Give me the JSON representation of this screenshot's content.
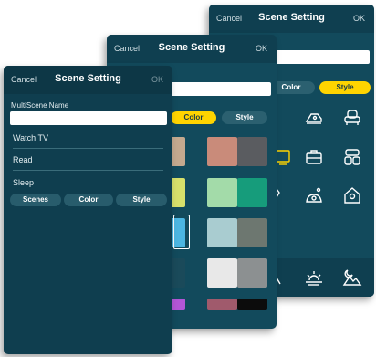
{
  "screen3": {
    "cancel": "Cancel",
    "title": "Scene Setting",
    "ok": "OK",
    "tabs": [
      {
        "label": "Color",
        "active": false
      },
      {
        "label": "Style",
        "active": true
      }
    ],
    "icons": [
      "thermostat-icon",
      "sofa-icon",
      "monitor-icon",
      "briefcase-icon",
      "lanterns-icon",
      "swim-ring-icon",
      "bird-icon",
      "house-icon",
      "mountains-icon",
      "sunrise-icon",
      "moon-mountains-icon"
    ]
  },
  "screen2": {
    "cancel": "Cancel",
    "title": "Scene Setting",
    "ok": "OK",
    "tabs": [
      {
        "label": "Color",
        "active": true
      },
      {
        "label": "Style",
        "active": false
      }
    ],
    "swatches": [
      "#c4a98f",
      "#c98b7a",
      "#5a5c60",
      "#d7e06b",
      "#a3dba9",
      "#169c7b",
      "#4cb6e2",
      "#a9ccd0",
      "#6d7770",
      "#1a4a5a",
      "#e8e8e8",
      "#8c9091",
      "#b256d6",
      "#a05a6c",
      "#0c0c0c"
    ]
  },
  "screen1": {
    "cancel": "Cancel",
    "title": "Scene Setting",
    "ok": "OK",
    "name_label": "MultiScene Name",
    "name_value": "",
    "scenes": [
      "Watch TV",
      "Read",
      "Sleep"
    ],
    "tabs": [
      {
        "label": "Scenes",
        "active": false
      },
      {
        "label": "Color",
        "active": false
      },
      {
        "label": "Style",
        "active": false
      }
    ]
  }
}
